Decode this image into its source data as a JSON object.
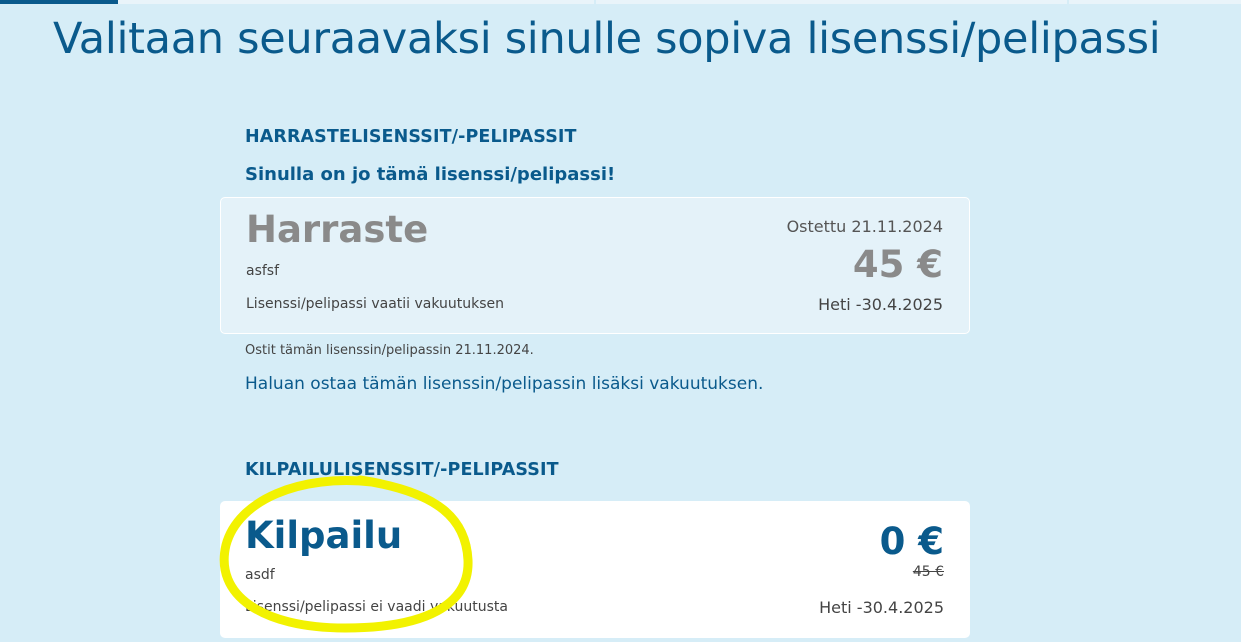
{
  "page_title": "Valitaan seuraavaksi sinulle sopiva lisenssi/pelipassi",
  "hobby_section": {
    "heading": "HARRASTELISENSSIT/-PELIPASSIT",
    "owned_note": "Sinulla on jo tämä lisenssi/pelipassi!",
    "card": {
      "name": "Harraste",
      "description": "asfsf",
      "insurance_note": "Lisenssi/pelipassi vaatii vakuutuksen",
      "purchased": "Ostettu 21.11.2024",
      "price": "45 €",
      "validity": "Heti -30.4.2025"
    },
    "bought_text": "Ostit tämän lisenssin/pelipassin 21.11.2024.",
    "insurance_link": "Haluan ostaa tämän lisenssin/pelipassin lisäksi vakuutuksen."
  },
  "competition_section": {
    "heading": "KILPAILULISENSSIT/-PELIPASSIT",
    "card": {
      "name": "Kilpailu",
      "description": "asdf",
      "insurance_note": "Lisenssi/pelipassi ei vaadi vakuutusta",
      "price": "0 €",
      "old_price": "45 €",
      "validity": "Heti -30.4.2025"
    }
  },
  "colors": {
    "background": "#d6edf7",
    "accent": "#0a5a8c",
    "highlight": "#f2f200"
  }
}
